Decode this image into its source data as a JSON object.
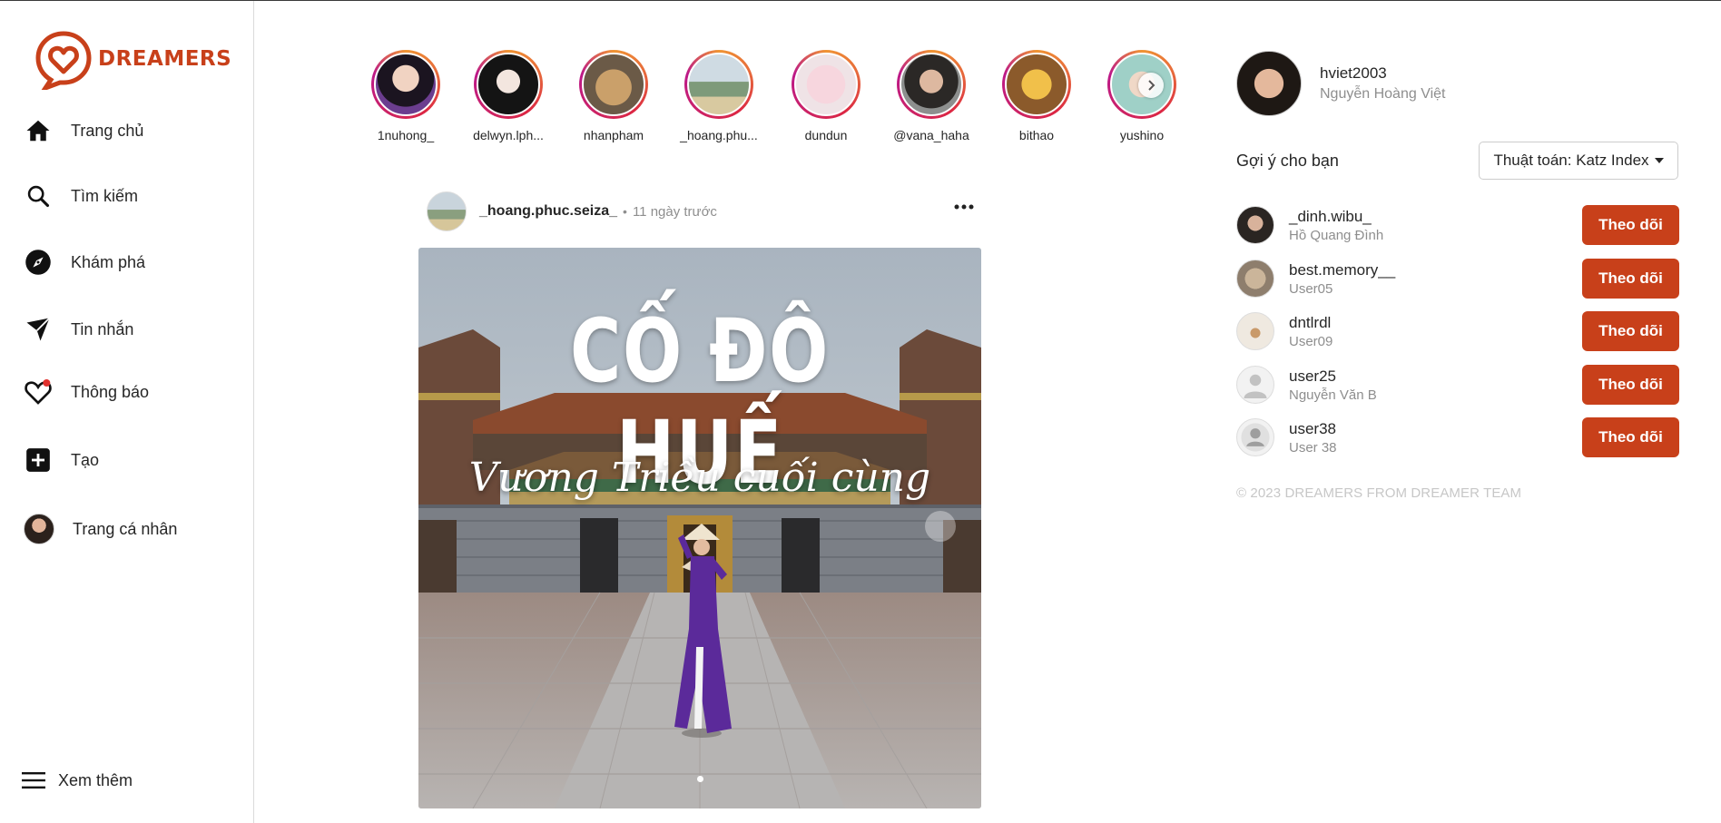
{
  "brand": {
    "name": "DREAMERS",
    "color": "#c8401a"
  },
  "sidebar": {
    "items": [
      {
        "label": "Trang chủ",
        "icon": "home-icon"
      },
      {
        "label": "Tìm kiếm",
        "icon": "search-icon"
      },
      {
        "label": "Khám phá",
        "icon": "compass-icon"
      },
      {
        "label": "Tin nhắn",
        "icon": "paper-plane-icon"
      },
      {
        "label": "Thông báo",
        "icon": "heart-icon"
      },
      {
        "label": "Tạo",
        "icon": "plus-square-icon"
      },
      {
        "label": "Trang cá nhân",
        "icon": "avatar"
      }
    ],
    "more_label": "Xem thêm"
  },
  "stories": [
    {
      "username": "1nuhong_"
    },
    {
      "username": "delwyn.lph..."
    },
    {
      "username": "nhanpham"
    },
    {
      "username": "_hoang.phu..."
    },
    {
      "username": "dundun"
    },
    {
      "username": "@vana_haha"
    },
    {
      "username": "bithao"
    },
    {
      "username": "yushino"
    }
  ],
  "post": {
    "username": "_hoang.phuc.seiza_",
    "separator": "•",
    "time": "11 ngày trước",
    "image_title": "CỐ ĐÔ HUẾ",
    "image_subtitle": "Vương Triều cuối cùng"
  },
  "current_user": {
    "username": "hviet2003",
    "full_name": "Nguyễn Hoàng Việt"
  },
  "suggestions": {
    "title": "Gợi ý cho bạn",
    "algorithm_label": "Thuật toán: Katz Index",
    "follow_label": "Theo dõi",
    "users": [
      {
        "username": "_dinh.wibu_",
        "full_name": "Hồ Quang Đình"
      },
      {
        "username": "best.memory__",
        "full_name": "User05"
      },
      {
        "username": "dntlrdl",
        "full_name": "User09"
      },
      {
        "username": "user25",
        "full_name": "Nguyễn Văn B"
      },
      {
        "username": "user38",
        "full_name": "User 38"
      }
    ]
  },
  "footer": {
    "text": "© 2023 DREAMERS FROM DREAMER TEAM"
  }
}
